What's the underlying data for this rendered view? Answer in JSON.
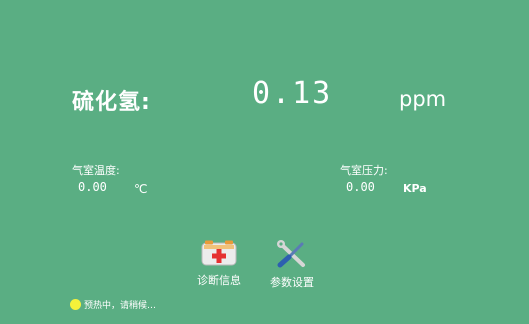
{
  "gas": {
    "label": "硫化氢:",
    "value": "0.13",
    "unit": "ppm"
  },
  "temperature": {
    "label": "气室温度:",
    "value": "0.00",
    "unit": "℃"
  },
  "pressure": {
    "label": "气室压力:",
    "value": "0.00",
    "unit": "KPa"
  },
  "buttons": {
    "diagnostics": {
      "label": "诊断信息",
      "icon": "first-aid-kit-icon"
    },
    "parameters": {
      "label": "参数设置",
      "icon": "wrench-screwdriver-icon"
    }
  },
  "status": {
    "text": "预热中，请稍候…",
    "indicator_color": "#f4f23a"
  },
  "colors": {
    "background": "#5aae83"
  }
}
